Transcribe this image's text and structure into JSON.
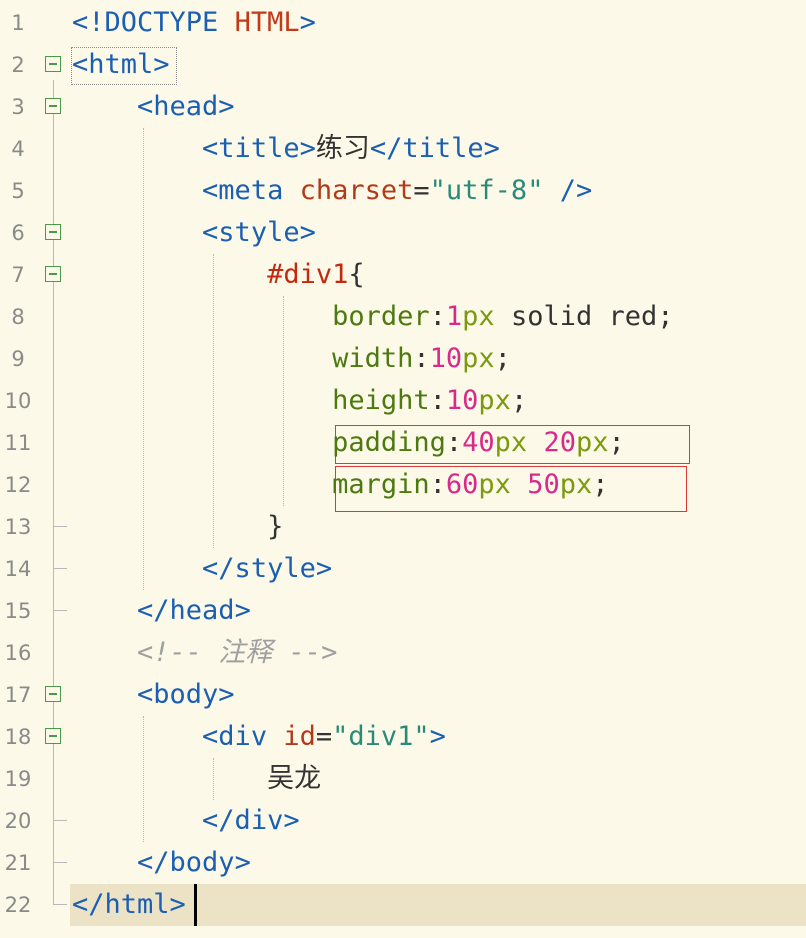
{
  "editor": {
    "lines": [
      {
        "no": "1",
        "parts": [
          [
            "<!DOCTYPE ",
            "tag"
          ],
          [
            "HTML",
            "doctype-kw"
          ],
          [
            ">",
            "tag"
          ]
        ]
      },
      {
        "no": "2",
        "parts": [
          [
            "<html>",
            "tag"
          ]
        ]
      },
      {
        "no": "3",
        "parts": [
          [
            "    ",
            "plain"
          ],
          [
            "<head>",
            "tag"
          ]
        ]
      },
      {
        "no": "4",
        "parts": [
          [
            "        ",
            "plain"
          ],
          [
            "<title>",
            "tag"
          ],
          [
            "练习",
            "plain"
          ],
          [
            "</title>",
            "tag"
          ]
        ]
      },
      {
        "no": "5",
        "parts": [
          [
            "        ",
            "plain"
          ],
          [
            "<meta ",
            "tag"
          ],
          [
            "charset",
            "attr"
          ],
          [
            "=",
            "plain"
          ],
          [
            "\"utf-8\"",
            "str"
          ],
          [
            " />",
            "tag"
          ]
        ]
      },
      {
        "no": "6",
        "parts": [
          [
            "        ",
            "plain"
          ],
          [
            "<style>",
            "tag"
          ]
        ]
      },
      {
        "no": "7",
        "parts": [
          [
            "            ",
            "plain"
          ],
          [
            "#div1",
            "sel"
          ],
          [
            "{",
            "plain"
          ]
        ]
      },
      {
        "no": "8",
        "parts": [
          [
            "                ",
            "plain"
          ],
          [
            "border",
            "prop"
          ],
          [
            ":",
            "plain"
          ],
          [
            "1",
            "num"
          ],
          [
            "px",
            "unit"
          ],
          [
            " solid red;",
            "plain"
          ]
        ]
      },
      {
        "no": "9",
        "parts": [
          [
            "                ",
            "plain"
          ],
          [
            "width",
            "prop"
          ],
          [
            ":",
            "plain"
          ],
          [
            "10",
            "num"
          ],
          [
            "px",
            "unit"
          ],
          [
            ";",
            "plain"
          ]
        ]
      },
      {
        "no": "10",
        "parts": [
          [
            "                ",
            "plain"
          ],
          [
            "height",
            "prop"
          ],
          [
            ":",
            "plain"
          ],
          [
            "10",
            "num"
          ],
          [
            "px",
            "unit"
          ],
          [
            ";",
            "plain"
          ]
        ]
      },
      {
        "no": "11",
        "parts": [
          [
            "                ",
            "plain"
          ],
          [
            "padding",
            "prop"
          ],
          [
            ":",
            "plain"
          ],
          [
            "40",
            "num"
          ],
          [
            "px ",
            "unit"
          ],
          [
            "20",
            "num"
          ],
          [
            "px",
            "unit"
          ],
          [
            ";",
            "plain"
          ]
        ]
      },
      {
        "no": "12",
        "parts": [
          [
            "                ",
            "plain"
          ],
          [
            "margin",
            "prop"
          ],
          [
            ":",
            "plain"
          ],
          [
            "60",
            "num"
          ],
          [
            "px ",
            "unit"
          ],
          [
            "50",
            "num"
          ],
          [
            "px",
            "unit"
          ],
          [
            ";",
            "plain"
          ]
        ]
      },
      {
        "no": "13",
        "parts": [
          [
            "            ",
            "plain"
          ],
          [
            "}",
            "plain"
          ]
        ]
      },
      {
        "no": "14",
        "parts": [
          [
            "        ",
            "plain"
          ],
          [
            "</style>",
            "tag"
          ]
        ]
      },
      {
        "no": "15",
        "parts": [
          [
            "    ",
            "plain"
          ],
          [
            "</head>",
            "tag"
          ]
        ]
      },
      {
        "no": "16",
        "parts": [
          [
            "    ",
            "plain"
          ],
          [
            "<!-- 注释 -->",
            "comment"
          ]
        ]
      },
      {
        "no": "17",
        "parts": [
          [
            "    ",
            "plain"
          ],
          [
            "<body>",
            "tag"
          ]
        ]
      },
      {
        "no": "18",
        "parts": [
          [
            "        ",
            "plain"
          ],
          [
            "<div ",
            "tag"
          ],
          [
            "id",
            "attr"
          ],
          [
            "=",
            "plain"
          ],
          [
            "\"div1\"",
            "str"
          ],
          [
            ">",
            "tag"
          ]
        ]
      },
      {
        "no": "19",
        "parts": [
          [
            "            ",
            "plain"
          ],
          [
            "吴龙",
            "plain"
          ]
        ]
      },
      {
        "no": "20",
        "parts": [
          [
            "        ",
            "plain"
          ],
          [
            "</div>",
            "tag"
          ]
        ]
      },
      {
        "no": "21",
        "parts": [
          [
            "    ",
            "plain"
          ],
          [
            "</body>",
            "tag"
          ]
        ]
      },
      {
        "no": "22",
        "parts": [
          [
            "</html>",
            "tag"
          ]
        ]
      }
    ],
    "fold_markers": [
      "2",
      "3",
      "6",
      "7",
      "17",
      "18"
    ],
    "current_line": "22",
    "highlighted_lines": [
      "11",
      "12"
    ]
  }
}
